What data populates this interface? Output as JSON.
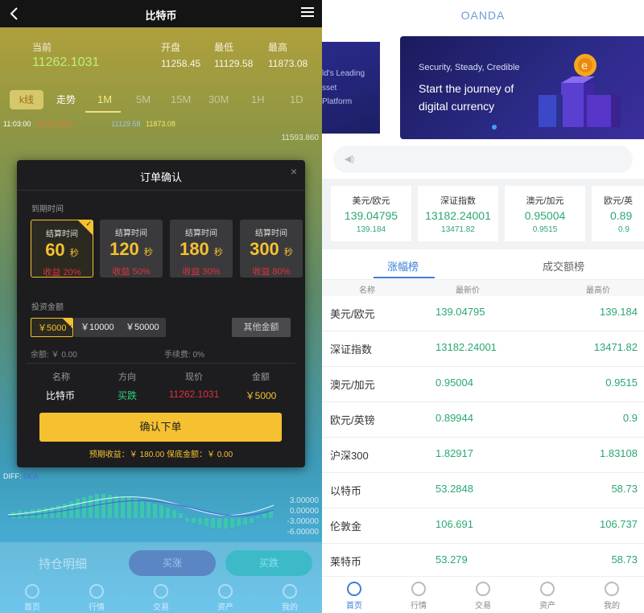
{
  "left": {
    "header": {
      "title": "比特币"
    },
    "quote": {
      "labels": {
        "current": "当前",
        "open": "开盘",
        "low": "最低",
        "high": "最高"
      },
      "current": "11262.1031",
      "open": "11258.45",
      "low": "11129.58",
      "high": "11873.08"
    },
    "tabs": {
      "kline": "k线",
      "trend": "走势",
      "t1m": "1M",
      "t5m": "5M",
      "t15m": "15M",
      "t30m": "30M",
      "t1h": "1H",
      "t1d": "1D"
    },
    "kinfo": {
      "time": "11:03:00",
      "a": "11262.1031",
      "b": "11129.58",
      "c": "11873.08"
    },
    "axis": {
      "a1": "11593.860",
      "a2": "3.00000",
      "a3": "0.00000",
      "a4": "-3.00000",
      "a5": "-6.00000"
    },
    "diff": {
      "label": "DIFF:",
      "value": "DEA"
    },
    "bottom": {
      "hold": "持仓明细",
      "up": "买涨",
      "down": "买跌"
    },
    "nav": {
      "home": "首页",
      "market": "行情",
      "trade": "交易",
      "assets": "资产",
      "mine": "我的"
    },
    "modal": {
      "title": "订单确认",
      "close": "×",
      "expiry_label": "到期时间",
      "time_label": "结算时间",
      "cards": [
        {
          "value": "60",
          "unit": "秒",
          "rate": "收益 20%"
        },
        {
          "value": "120",
          "unit": "秒",
          "rate": "收益 50%"
        },
        {
          "value": "180",
          "unit": "秒",
          "rate": "收益 30%"
        },
        {
          "value": "300",
          "unit": "秒",
          "rate": "收益 80%"
        }
      ],
      "invest_label": "投资金额",
      "amounts": {
        "a1": "￥5000",
        "a2": "￥10000",
        "a3": "￥50000",
        "other": "其他金额"
      },
      "balance": "余额: ￥ 0.00",
      "fee": "手续费: 0%",
      "table": {
        "h_name": "名称",
        "h_dir": "方向",
        "h_price": "现价",
        "h_amount": "金额",
        "name": "比特币",
        "dir": "买跌",
        "price": "11262.1031",
        "amount": "￥5000"
      },
      "confirm": "确认下单",
      "footer": "预期收益：￥ 180.00    保底金额：￥ 0.00"
    }
  },
  "right": {
    "logo": "OANDA",
    "banner_prev": {
      "l1": "ld's Leading",
      "l2": "sset",
      "l3": "Platform"
    },
    "banner": {
      "small": "Security, Steady, Credible",
      "big1": "Start the journey of",
      "big2": "digital currency"
    },
    "cards": [
      {
        "name": "美元/欧元",
        "value": "139.04795",
        "sub": "139.184"
      },
      {
        "name": "深证指数",
        "value": "13182.24001",
        "sub": "13471.82"
      },
      {
        "name": "澳元/加元",
        "value": "0.95004",
        "sub": "0.9515"
      },
      {
        "name": "欧元/英",
        "value": "0.89",
        "sub": "0.9"
      }
    ],
    "tabs": {
      "gain": "涨幅榜",
      "volume": "成交额榜"
    },
    "table_head": {
      "name": "名称",
      "last": "最新价",
      "high": "最高价"
    },
    "rows": [
      {
        "name": "美元/欧元",
        "last": "139.04795",
        "high": "139.184"
      },
      {
        "name": "深证指数",
        "last": "13182.24001",
        "high": "13471.82"
      },
      {
        "name": "澳元/加元",
        "last": "0.95004",
        "high": "0.9515"
      },
      {
        "name": "欧元/英镑",
        "last": "0.89944",
        "high": "0.9"
      },
      {
        "name": "沪深300",
        "last": "1.82917",
        "high": "1.83108"
      },
      {
        "name": "以特币",
        "last": "53.2848",
        "high": "58.73"
      },
      {
        "name": "伦敦金",
        "last": "106.691",
        "high": "106.737"
      },
      {
        "name": "莱特币",
        "last": "53.279",
        "high": "58.73"
      }
    ],
    "nav": {
      "home": "首页",
      "market": "行情",
      "trade": "交易",
      "assets": "资产",
      "mine": "我的"
    }
  }
}
